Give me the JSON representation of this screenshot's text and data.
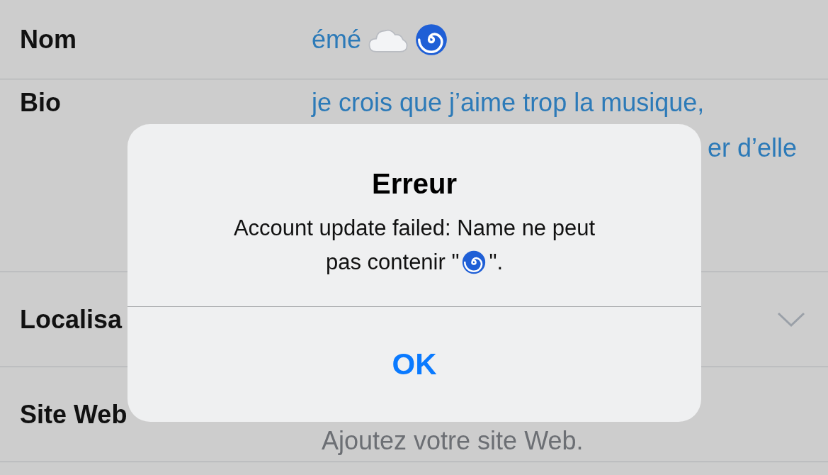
{
  "profile_fields": [
    {
      "label": "Nom",
      "kind": "value",
      "lines": [
        [
          {
            "kind": "text",
            "text": "émé"
          },
          {
            "kind": "cloud"
          },
          {
            "kind": "cyclone"
          }
        ]
      ]
    },
    {
      "label": "Bio",
      "kind": "value",
      "lines": [
        [
          {
            "kind": "text",
            "text": "je crois que j’aime trop la musique,"
          }
        ],
        [
          {
            "kind": "text",
            "text": "er d’elle"
          }
        ]
      ]
    },
    {
      "label": "Localisa",
      "kind": "dropdown"
    },
    {
      "label": "Site Web",
      "kind": "placeholder",
      "placeholder": "Ajoutez votre site Web."
    }
  ],
  "alert": {
    "title": "Erreur",
    "message_lines": [
      [
        {
          "kind": "text",
          "text": "Account update failed: Name ne peut"
        }
      ],
      [
        {
          "kind": "text",
          "text": "pas contenir \""
        },
        {
          "kind": "cyclone"
        },
        {
          "kind": "text",
          "text": "\"."
        }
      ]
    ],
    "buttons": [
      "OK"
    ]
  }
}
